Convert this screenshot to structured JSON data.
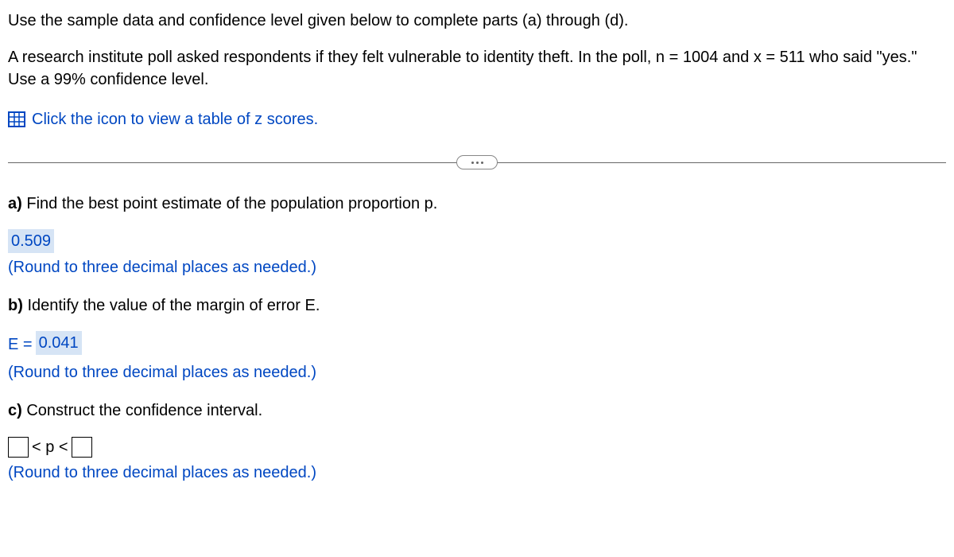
{
  "intro": "Use the sample data and confidence level given below to complete parts (a) through (d).",
  "problem": "A research institute poll asked respondents if they felt vulnerable to identity theft. In the poll, n = 1004 and x = 511 who said \"yes.\" Use a 99% confidence level.",
  "zlink": "Click the icon to view a table of z scores.",
  "partA": {
    "label": "a)",
    "text": " Find the best point estimate of the population proportion p.",
    "value": "0.509",
    "hint": "(Round to three decimal places as needed.)"
  },
  "partB": {
    "label": "b)",
    "text": " Identify the value of the margin of error E.",
    "prefix": "E = ",
    "value": "0.041",
    "hint": "(Round to three decimal places as needed.)"
  },
  "partC": {
    "label": "c)",
    "text": " Construct the confidence interval.",
    "lt1": "< p <",
    "hint": "(Round to three decimal places as needed.)"
  }
}
